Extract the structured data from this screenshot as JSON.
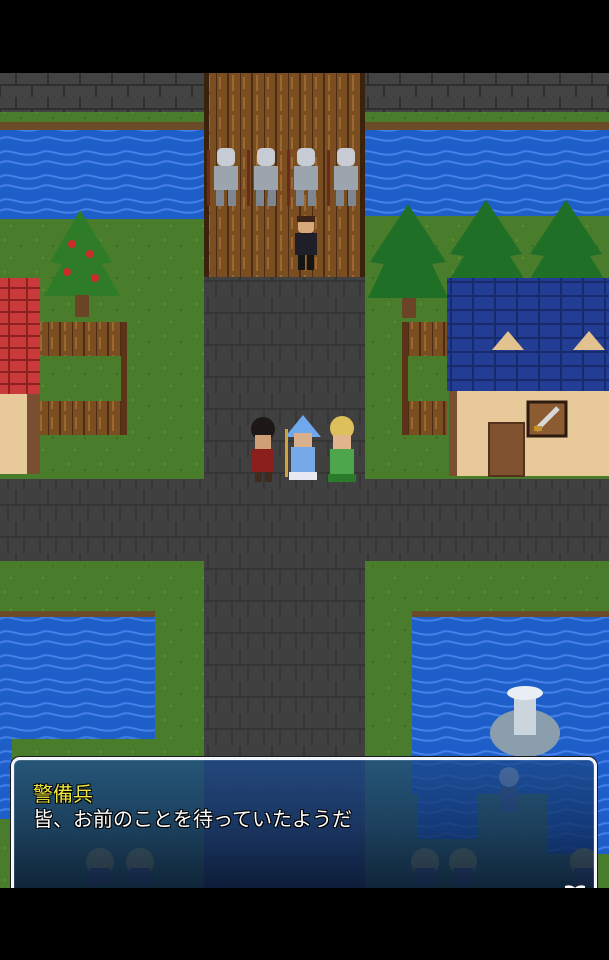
{
  "dialog": {
    "speaker": "警備兵",
    "message": "皆、お前のことを待っていたようだ"
  },
  "icons": {
    "advance": "book-icon"
  },
  "colors": {
    "water": "#1a63cf",
    "grass": "#4a7d2b",
    "stone": "#3f3f3f",
    "speaker_text": "#f0e63d"
  }
}
